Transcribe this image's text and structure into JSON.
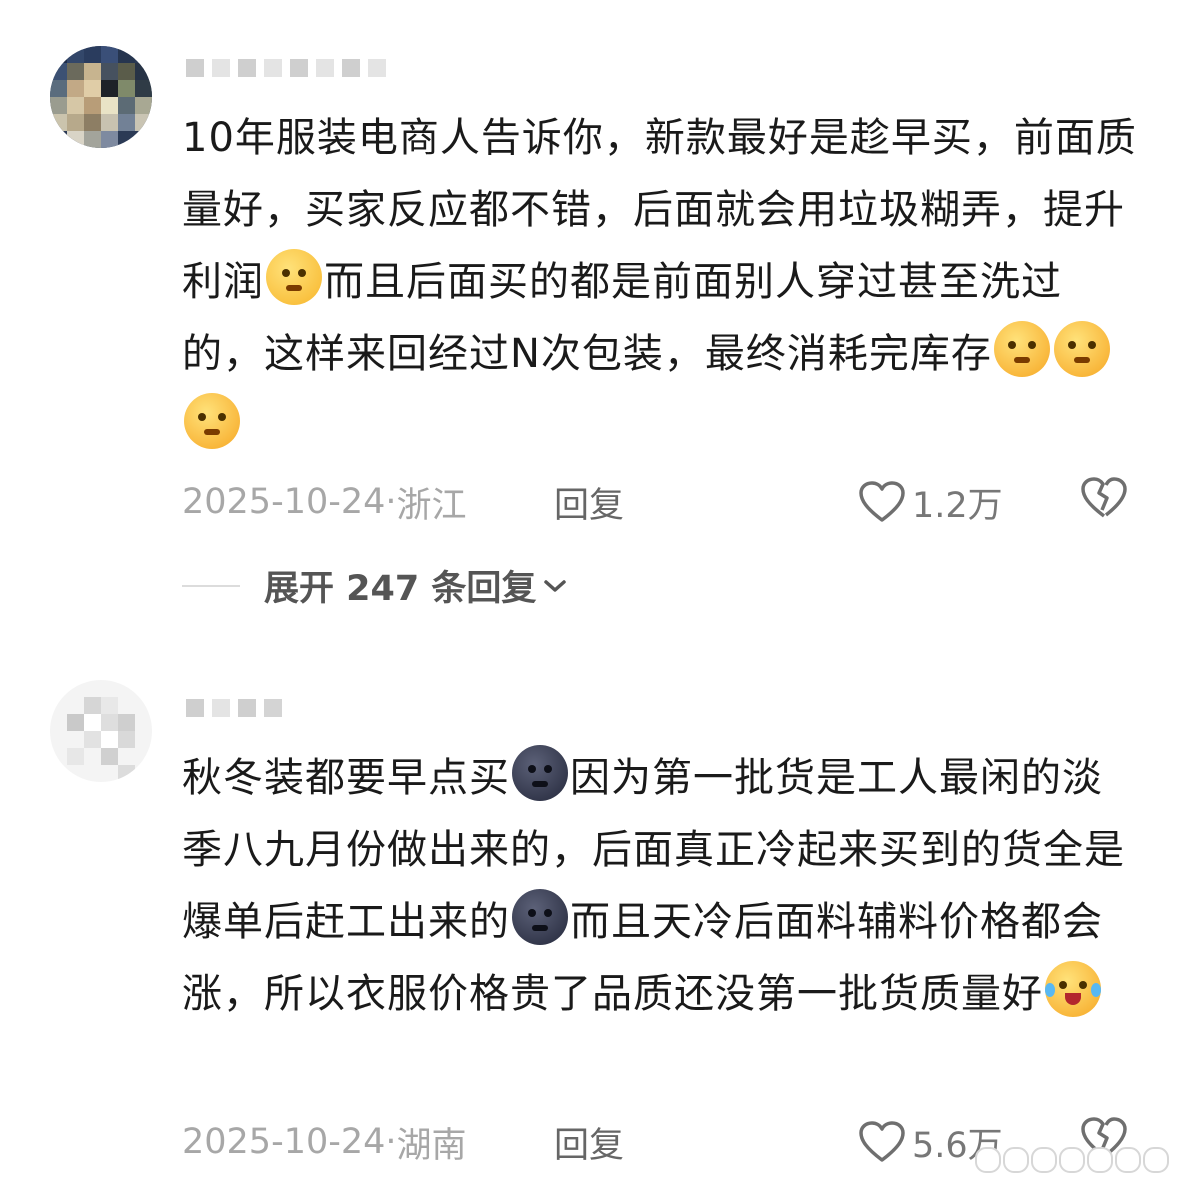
{
  "comments": [
    {
      "text_parts": [
        "10年服装电商人告诉你，新款最好是趁早买，前面质量好，买家反应都不错，后面就会用垃圾糊弄，提升利润",
        "而且后面买的都是前面别人穿过甚至洗过的，这样来回经过N次包装，最终消耗完库存"
      ],
      "emojis": [
        "pleading-face-emoji",
        "smirk-face-emoji",
        "smirk-face-emoji",
        "smirk-face-emoji"
      ],
      "date": "2025-10-24·",
      "location": "浙江",
      "reply_label": "回复",
      "likes": "1.2万",
      "expand_label": "展开 247 条回复"
    },
    {
      "text_parts": [
        "秋冬装都要早点买",
        "因为第一批货是工人最闲的淡季八九月份做出来的，后面真正冷起来买到的货全是爆单后赶工出来的",
        "而且天冷后面料辅料价格都会涨，所以衣服价格贵了品质还没第一批货质量好"
      ],
      "emojis": [
        "new-moon-face-emoji",
        "new-moon-face-emoji",
        "laughing-crying-emoji"
      ],
      "date": "2025-10-24·",
      "location": "湖南",
      "reply_label": "回复",
      "likes": "5.6万"
    }
  ],
  "colors": {
    "meta_gray": "#a7a7a7",
    "text": "#1a1a1a"
  }
}
